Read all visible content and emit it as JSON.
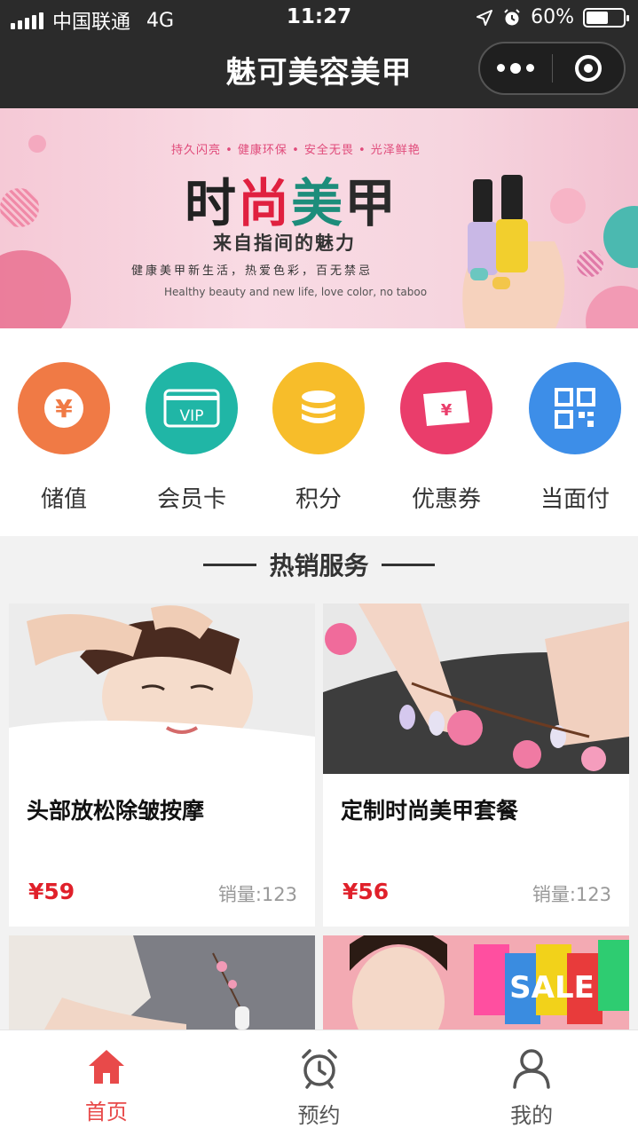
{
  "status_bar": {
    "carrier": "中国联通",
    "network": "4G",
    "time": "11:27",
    "battery": "60%",
    "battery_level": 0.6
  },
  "header": {
    "title": "魅可美容美甲",
    "more_icon": "more-dots-icon",
    "close_icon": "target-icon"
  },
  "banner": {
    "tagline": "持久闪亮 • 健康环保 • 安全无畏 • 光泽鲜艳",
    "headline": [
      "时",
      "尚",
      "美",
      "甲"
    ],
    "subtitle": "来自指间的魅力",
    "description": "健康美甲新生活，热爱色彩，百无禁忌",
    "description_en": "Healthy beauty and new life,  love color,  no taboo"
  },
  "menu": {
    "items": [
      {
        "label": "储值",
        "icon": "yen-coin-icon",
        "color": "#f07a45"
      },
      {
        "label": "会员卡",
        "icon": "vip-card-icon",
        "color": "#20b6a6"
      },
      {
        "label": "积分",
        "icon": "coin-stack-icon",
        "color": "#f7bd2a"
      },
      {
        "label": "优惠券",
        "icon": "coupon-icon",
        "color": "#ea3d6b"
      },
      {
        "label": "当面付",
        "icon": "qr-code-icon",
        "color": "#3d8ee8"
      }
    ]
  },
  "section": {
    "title": "热销服务"
  },
  "products": [
    {
      "name": "头部放松除皱按摩",
      "price": "¥59",
      "sales": "销量:123"
    },
    {
      "name": "定制时尚美甲套餐",
      "price": "¥56",
      "sales": "销量:123"
    },
    {
      "name": "",
      "price": "",
      "sales": ""
    },
    {
      "name": "",
      "price": "",
      "sales": ""
    }
  ],
  "sale_sign": "SALE",
  "tabbar": {
    "items": [
      {
        "label": "首页",
        "icon": "home-icon",
        "active": true
      },
      {
        "label": "预约",
        "icon": "alarm-clock-icon",
        "active": false
      },
      {
        "label": "我的",
        "icon": "user-icon",
        "active": false
      }
    ],
    "active_color": "#e84a4a"
  }
}
